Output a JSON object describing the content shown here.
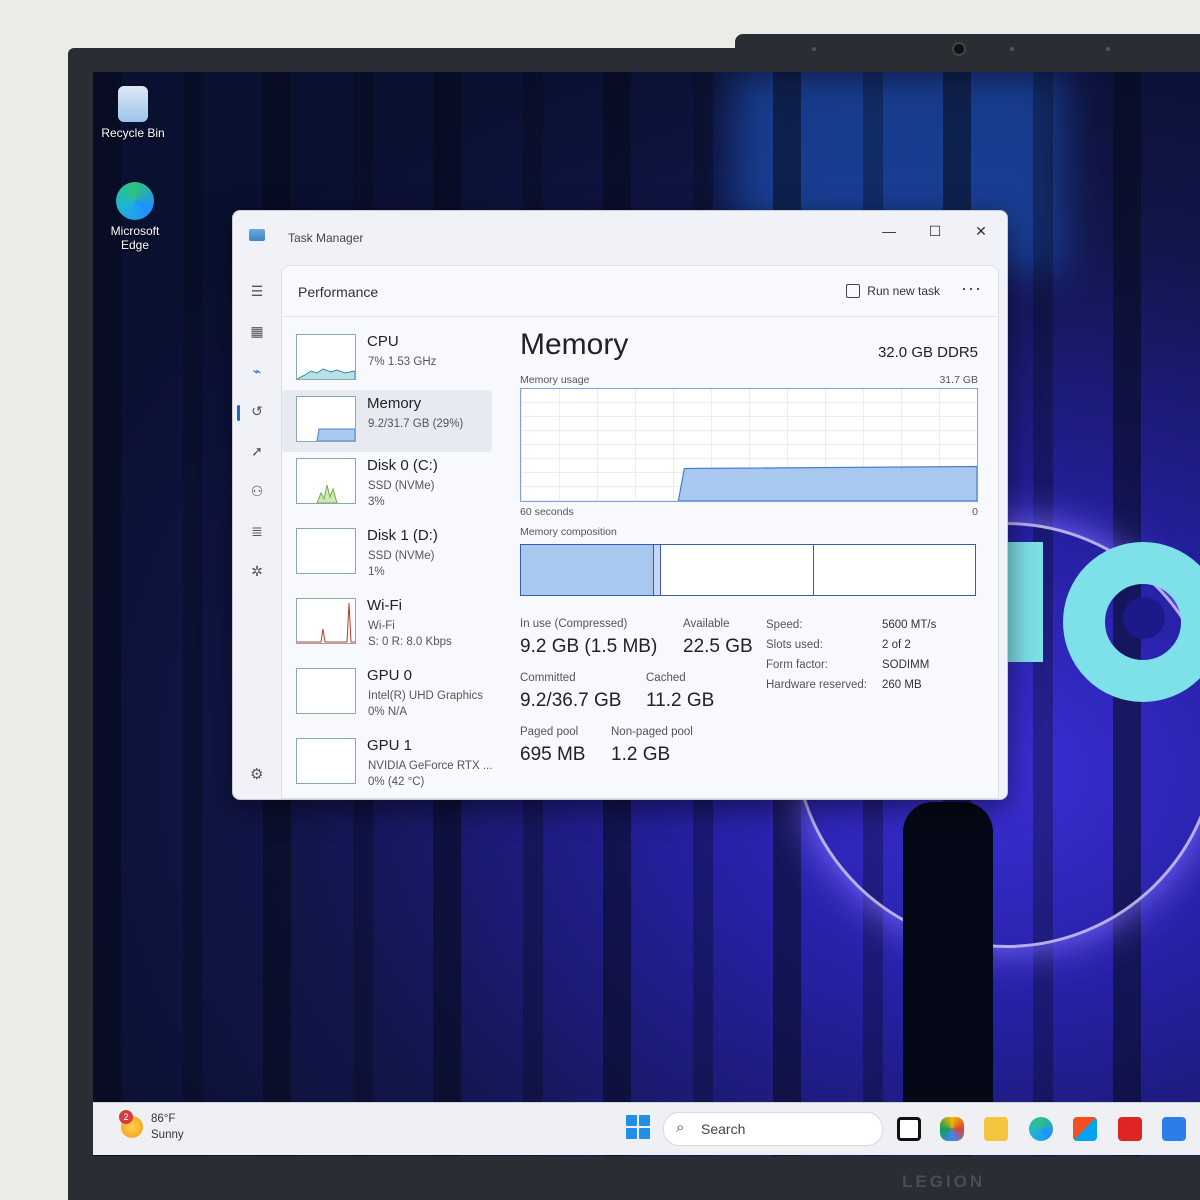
{
  "desktop": {
    "icons": [
      {
        "label": "Recycle Bin"
      },
      {
        "label": "Microsoft Edge"
      }
    ]
  },
  "window": {
    "title": "Task Manager",
    "controls": {
      "minimize": "—",
      "maximize": "☐",
      "close": "✕"
    }
  },
  "header": {
    "page_title": "Performance",
    "run_new_task": "Run new task",
    "more": "···"
  },
  "devices": [
    {
      "name": "CPU",
      "sub1": "7%  1.53 GHz",
      "sub2": "",
      "color": "#2a8fa8"
    },
    {
      "name": "Memory",
      "sub1": "9.2/31.7 GB (29%)",
      "sub2": "",
      "color": "#4a7fd0"
    },
    {
      "name": "Disk 0 (C:)",
      "sub1": "SSD (NVMe)",
      "sub2": "3%",
      "color": "#6ab04c"
    },
    {
      "name": "Disk 1 (D:)",
      "sub1": "SSD (NVMe)",
      "sub2": "1%",
      "color": "#6ab04c"
    },
    {
      "name": "Wi-Fi",
      "sub1": "Wi-Fi",
      "sub2": "S: 0  R: 8.0 Kbps",
      "color": "#c0392b"
    },
    {
      "name": "GPU 0",
      "sub1": "Intel(R) UHD Graphics",
      "sub2": "0%  N/A",
      "color": "#888888"
    },
    {
      "name": "GPU 1",
      "sub1": "NVIDIA GeForce RTX ...",
      "sub2": "0%  (42 °C)",
      "color": "#888888"
    }
  ],
  "memory": {
    "title": "Memory",
    "spec": "32.0 GB DDR5",
    "usage_label": "Memory usage",
    "usage_max": "31.7 GB",
    "time_label": "60 seconds",
    "zero_label": "0",
    "usage_fraction": 0.29,
    "composition_label": "Memory composition",
    "stats": {
      "in_use_label": "In use (Compressed)",
      "in_use": "9.2 GB (1.5 MB)",
      "available_label": "Available",
      "available": "22.5 GB",
      "committed_label": "Committed",
      "committed": "9.2/36.7 GB",
      "cached_label": "Cached",
      "cached": "11.2 GB",
      "paged_label": "Paged pool",
      "paged": "695 MB",
      "nonpaged_label": "Non-paged pool",
      "nonpaged": "1.2 GB"
    },
    "details": [
      {
        "k": "Speed:",
        "v": "5600 MT/s"
      },
      {
        "k": "Slots used:",
        "v": "2 of 2"
      },
      {
        "k": "Form factor:",
        "v": "SODIMM"
      },
      {
        "k": "Hardware reserved:",
        "v": "260 MB"
      }
    ]
  },
  "taskbar": {
    "weather_badge": "2",
    "weather_temp": "86°F",
    "weather_cond": "Sunny",
    "search_placeholder": "Search",
    "search_icon": "search-icon"
  },
  "brand": "LEGION",
  "colors": {
    "accent": "#1e66d0",
    "memory_fill": "#a9c8ef",
    "memory_line": "#4a7fd0"
  }
}
